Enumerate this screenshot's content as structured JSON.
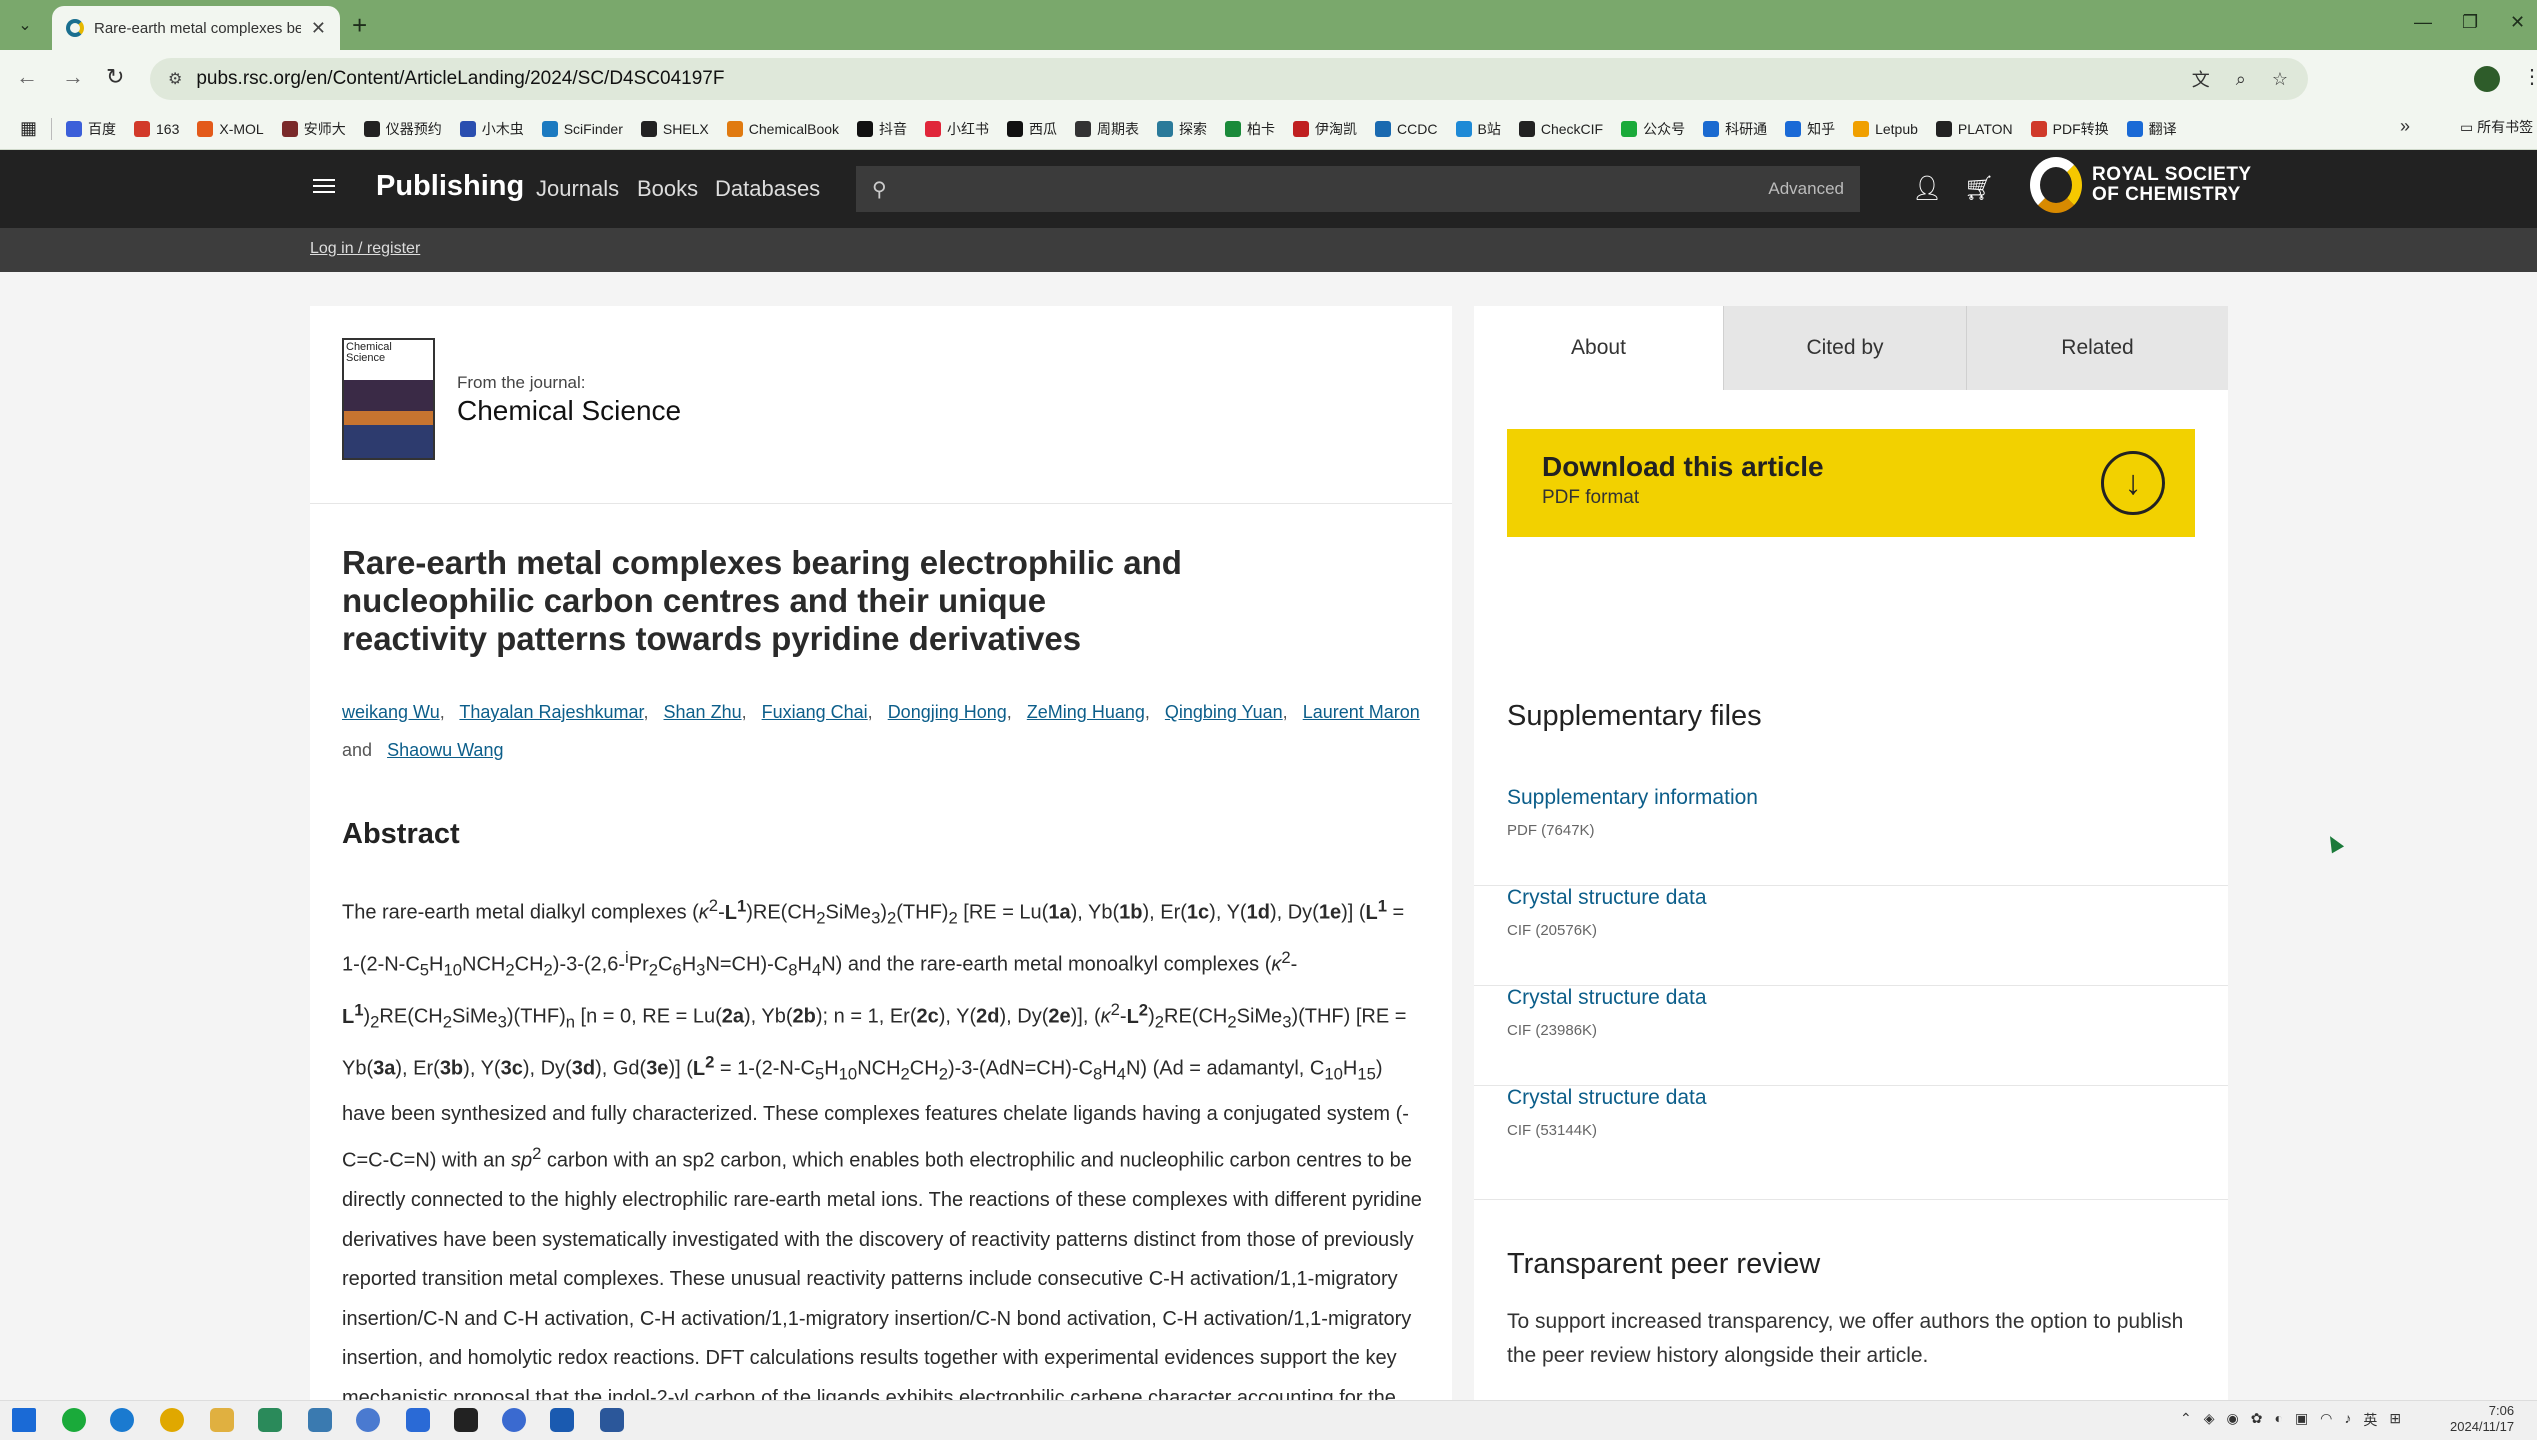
{
  "browser": {
    "tab_title": "Rare-earth metal complexes bearin",
    "url": "pubs.rsc.org/en/Content/ArticleLanding/2024/SC/D4SC04197F",
    "bookmarks": [
      {
        "label": "百度",
        "color": "#3b5fd9"
      },
      {
        "label": "163",
        "color": "#d23a2a"
      },
      {
        "label": "X-MOL",
        "color": "#e35a1a"
      },
      {
        "label": "安师大",
        "color": "#7a2a2a"
      },
      {
        "label": "仪器预约",
        "color": "#222222"
      },
      {
        "label": "小木虫",
        "color": "#2a4fb0"
      },
      {
        "label": "SciFinder",
        "color": "#1b7ac0"
      },
      {
        "label": "SHELX",
        "color": "#222222"
      },
      {
        "label": "ChemicalBook",
        "color": "#e07a10"
      },
      {
        "label": "抖音",
        "color": "#111111"
      },
      {
        "label": "小红书",
        "color": "#e0263a"
      },
      {
        "label": "西瓜",
        "color": "#111111"
      },
      {
        "label": "周期表",
        "color": "#333333"
      },
      {
        "label": "探索",
        "color": "#2a7a9a"
      },
      {
        "label": "柏卡",
        "color": "#1a8a3a"
      },
      {
        "label": "伊淘凯",
        "color": "#c02020"
      },
      {
        "label": "CCDC",
        "color": "#1a6ab0"
      },
      {
        "label": "B站",
        "color": "#1e8ad6"
      },
      {
        "label": "CheckCIF",
        "color": "#222222"
      },
      {
        "label": "公众号",
        "color": "#1aaa3a"
      },
      {
        "label": "科研通",
        "color": "#1a6ad0"
      },
      {
        "label": "知乎",
        "color": "#1a6ad6"
      },
      {
        "label": "Letpub",
        "color": "#f0a000"
      },
      {
        "label": "PLATON",
        "color": "#222222"
      },
      {
        "label": "PDF转换",
        "color": "#d03a2a"
      },
      {
        "label": "翻译",
        "color": "#1a6ad6"
      }
    ],
    "bookmarks_folder": "所有书签"
  },
  "rsc_nav": {
    "publishing": "Publishing",
    "links": [
      "Journals",
      "Books",
      "Databases"
    ],
    "search_placeholder": "",
    "advanced": "Advanced",
    "logo_line1": "ROYAL SOCIETY",
    "logo_line2": "OF CHEMISTRY",
    "login": "Log in / register"
  },
  "journal": {
    "cover_title": "Chemical Science",
    "from_label": "From the journal:",
    "name": "Chemical Science"
  },
  "article": {
    "title": "Rare-earth metal complexes bearing electrophilic and nucleophilic carbon centres and their unique reactivity patterns towards pyridine derivatives",
    "authors": [
      "weikang Wu",
      "Thayalan Rajeshkumar",
      "Shan Zhu",
      "Fuxiang Chai",
      "Dongjing Hong",
      "ZeMing Huang",
      "Qingbing Yuan",
      "Laurent Maron",
      "Shaowu Wang"
    ],
    "and_word": "and",
    "abstract_heading": "Abstract"
  },
  "side": {
    "tabs": [
      "About",
      "Cited by",
      "Related"
    ],
    "download_title": "Download this article",
    "download_sub": "PDF format",
    "supp_heading": "Supplementary files",
    "supp_items": [
      {
        "label": "Supplementary information",
        "meta": "PDF (7647K)"
      },
      {
        "label": "Crystal structure data",
        "meta": "CIF (20576K)"
      },
      {
        "label": "Crystal structure data",
        "meta": "CIF (23986K)"
      },
      {
        "label": "Crystal structure data",
        "meta": "CIF (53144K)"
      }
    ],
    "peer_heading": "Transparent peer review",
    "peer_text": "To support increased transparency, we offer authors the option to publish the peer review history alongside their article."
  },
  "taskbar": {
    "time": "7:06",
    "date": "2024/11/17",
    "ime": "英"
  },
  "icons": [
    "chevron-down-icon",
    "close-icon",
    "plus-icon",
    "minimize-icon",
    "maximize-icon",
    "back-icon",
    "forward-icon",
    "reload-icon",
    "translate-icon",
    "zoom-icon",
    "star-icon",
    "apps-icon",
    "menu-icon",
    "search-icon",
    "user-icon",
    "cart-icon",
    "download-icon"
  ]
}
